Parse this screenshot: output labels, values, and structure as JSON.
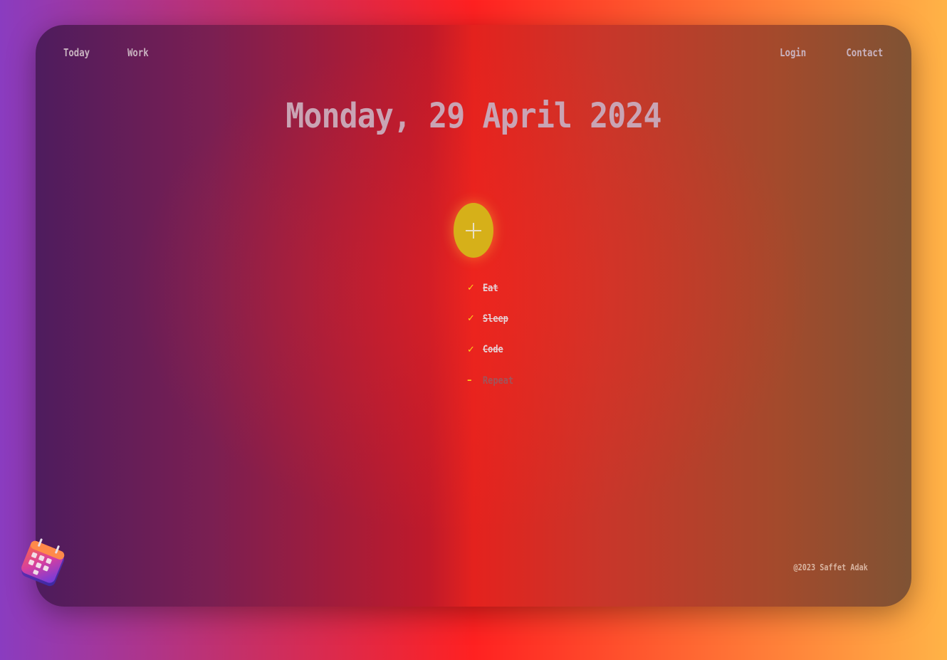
{
  "nav": {
    "left": [
      "Today",
      "Work"
    ],
    "right": [
      "Login",
      "Contact"
    ]
  },
  "title": "Monday, 29 April 2024",
  "add_button": {
    "icon": "plus-icon",
    "color": "#d6b019"
  },
  "todos": [
    {
      "label": "Eat",
      "done": true,
      "mark": "✓"
    },
    {
      "label": "Sleep",
      "done": true,
      "mark": "✓"
    },
    {
      "label": "Code",
      "done": true,
      "mark": "✓"
    },
    {
      "label": "Repeat",
      "done": false,
      "mark": "–"
    }
  ],
  "footer": "@2023 Saffet Adak",
  "logo": {
    "icon": "calendar-icon"
  },
  "colors": {
    "accent": "#d6b019",
    "check": "#ffd21a"
  }
}
